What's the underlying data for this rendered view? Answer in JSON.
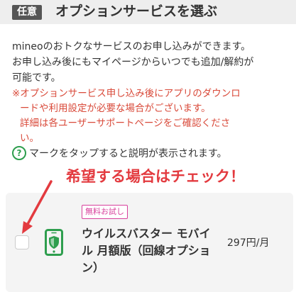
{
  "header": {
    "badge": "任意",
    "title": "オプションサービスを選ぶ"
  },
  "intro": {
    "lines": [
      "mineoのおトクなサービスのお申し込みができます。",
      "お申し込み後にもマイページからいつでも追加/解約が",
      "可能です。"
    ]
  },
  "notice": {
    "lines": [
      "※オプションサービス申し込み後にアプリのダウンロ",
      "ードや利用設定が必要な場合がございます。",
      "詳細は各ユーザーサポートページをご確認くださ",
      "い。"
    ]
  },
  "help": {
    "icon_glyph": "?",
    "text": "マークをタップすると説明が表示されます。"
  },
  "annotation": {
    "text": "希望する場合はチェック！",
    "color": "#e33a3f"
  },
  "service": {
    "tag": "無料お試し",
    "name_lines": [
      "ウイルスバスター モバイ",
      "ル 月額版（回線オプショ",
      "ン）"
    ],
    "price": "297円/月",
    "checked": false,
    "icon": "phone-shield-icon"
  },
  "colors": {
    "accent_green": "#2e9e4e",
    "notice_red": "#d94a3a",
    "tag_pink": "#d8409c"
  }
}
